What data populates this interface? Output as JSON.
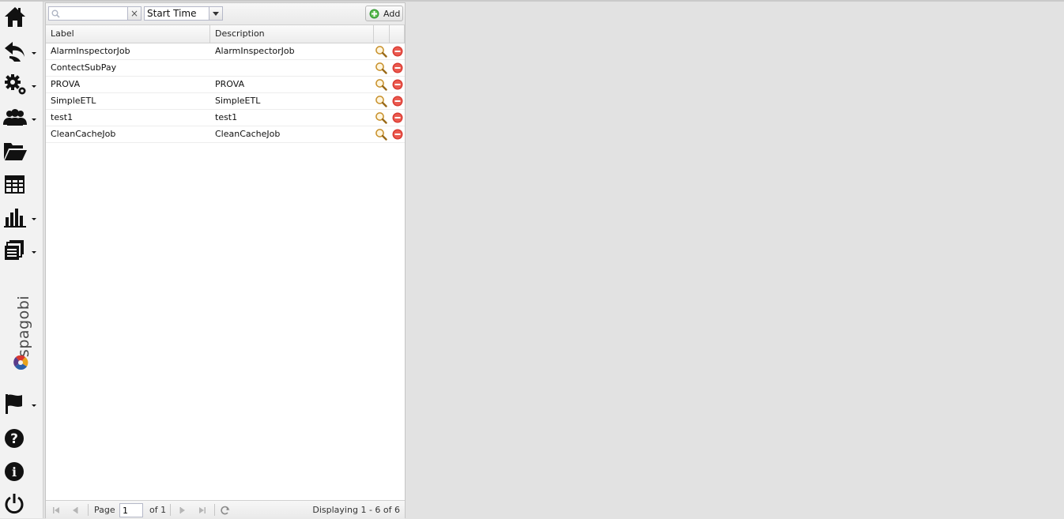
{
  "sidebar": {
    "items": [
      {
        "icon": "home-icon",
        "dropdown": false
      },
      {
        "icon": "share-arrow-icon",
        "dropdown": true
      },
      {
        "icon": "gears-icon",
        "dropdown": true
      },
      {
        "icon": "users-icon",
        "dropdown": true
      },
      {
        "icon": "folder-open-icon",
        "dropdown": false
      },
      {
        "icon": "table-icon",
        "dropdown": false
      },
      {
        "icon": "bar-chart-icon",
        "dropdown": true
      },
      {
        "icon": "documents-icon",
        "dropdown": true
      }
    ],
    "logo_text": "spagobi",
    "bottom_items": [
      {
        "icon": "flag-icon",
        "dropdown": true
      },
      {
        "icon": "help-icon",
        "dropdown": false
      },
      {
        "icon": "info-icon",
        "dropdown": false
      },
      {
        "icon": "power-icon",
        "dropdown": false
      }
    ]
  },
  "toolbar": {
    "search_value": "",
    "clear_label": "×",
    "sort_field": "Start Time",
    "add_label": "Add"
  },
  "grid": {
    "columns": [
      "Label",
      "Description"
    ],
    "rows": [
      {
        "label": "AlarmInspectorJob",
        "description": "AlarmInspectorJob"
      },
      {
        "label": "ContectSubPay",
        "description": ""
      },
      {
        "label": "PROVA",
        "description": "PROVA"
      },
      {
        "label": "SimpleETL",
        "description": "SimpleETL"
      },
      {
        "label": "test1",
        "description": "test1"
      },
      {
        "label": "CleanCacheJob",
        "description": "CleanCacheJob"
      }
    ]
  },
  "paging": {
    "page_label": "Page",
    "page_value": "1",
    "of_label": "of 1",
    "status": "Displaying 1 - 6 of 6"
  },
  "colors": {
    "accent_green": "#3a9b3a",
    "delete_red": "#d9372f",
    "magnifier": "#c8902a"
  }
}
